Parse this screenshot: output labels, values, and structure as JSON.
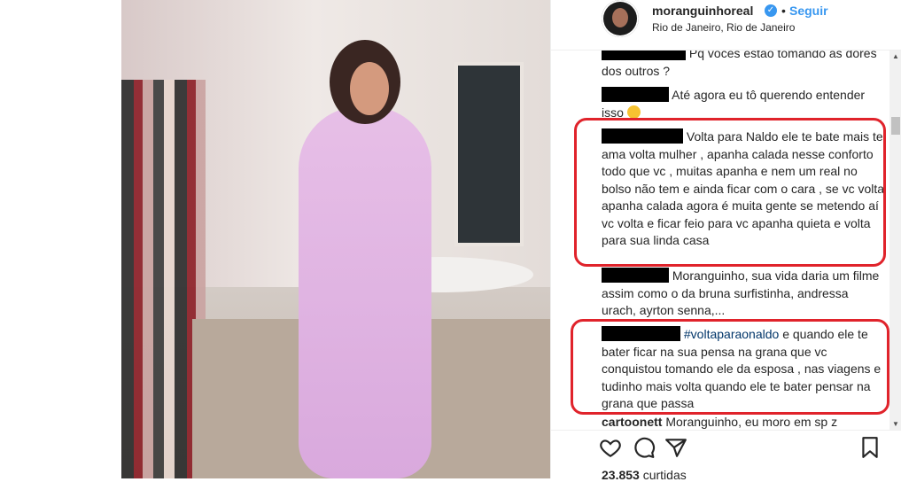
{
  "header": {
    "username": "moranguinhoreal",
    "verified_icon": "verified-badge-icon",
    "separator": "•",
    "follow_label": "Seguir",
    "location": "Rio de Janeiro, Rio de Janeiro"
  },
  "comments": [
    {
      "text": "Pq vocês estão tomando as dores dos outros ?"
    },
    {
      "text": "Até agora eu tô querendo entender isso",
      "emoji": "grinning-face-emoji"
    },
    {
      "text": "Volta para Naldo ele te bate mais te ama volta mulher , apanha calada nesse conforto todo que vc , muitas apanha e nem um real no bolso não tem e ainda ficar com o cara , se vc volta apanha calada agora é muita gente se metendo aí vc volta e ficar feio para vc apanha quieta e volta para sua linda casa"
    },
    {
      "text": "Moranguinho, sua vida daria um filme assim como o da bruna surfistinha, andressa urach, ayrton senna,..."
    },
    {
      "hashtag": "#voltaparaonaldo",
      "text": " e quando ele te bater ficar na sua pensa na grana que vc conquistou tomando ele da esposa , nas viagens e tudinho mais volta quando ele te bater pensar na grana que passa"
    },
    {
      "username": "cartoonett",
      "text": " Moranguinho, eu moro em sp z"
    }
  ],
  "actions": {
    "like_icon": "heart-icon",
    "comment_icon": "comment-icon",
    "share_icon": "share-icon",
    "save_icon": "bookmark-icon"
  },
  "likes": {
    "count": "23.853",
    "label": " curtidas"
  },
  "colors": {
    "accent": "#3897f0",
    "highlight_border": "#e0232b",
    "hashtag": "#003569"
  }
}
